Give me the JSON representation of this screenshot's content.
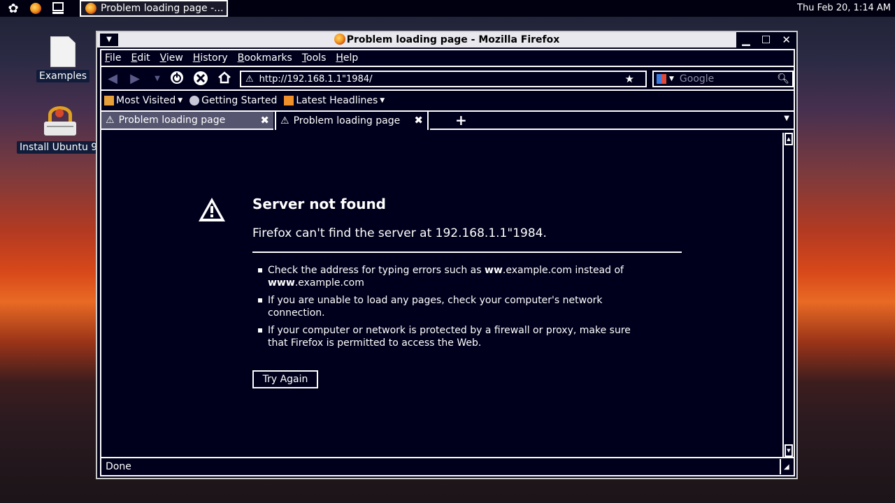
{
  "panel": {
    "task_label": "Problem loading page -...",
    "clock": "Thu Feb 20,  1:14 AM"
  },
  "desktop": {
    "icons": [
      {
        "label": "Examples"
      },
      {
        "label": "Install Ubuntu 9."
      }
    ]
  },
  "window": {
    "title": "Problem loading page - Mozilla Firefox"
  },
  "menubar": [
    "File",
    "Edit",
    "View",
    "History",
    "Bookmarks",
    "Tools",
    "Help"
  ],
  "navbar": {
    "url": "http://192.168.1.1\"1984/",
    "search_placeholder": "Google"
  },
  "bookmarks": [
    "Most Visited",
    "Getting Started",
    "Latest Headlines"
  ],
  "tabs": [
    {
      "label": "Problem loading page"
    },
    {
      "label": "Problem loading page"
    }
  ],
  "error_page": {
    "title": "Server not found",
    "subtitle": "Firefox can't find the server at 192.168.1.1\"1984.",
    "bullet1_prefix": "Check the address for typing errors such as ",
    "bullet1_bold1": "ww",
    "bullet1_mid": ".example.com instead of ",
    "bullet1_bold2": "www",
    "bullet1_suffix": ".example.com",
    "bullet2": "If you are unable to load any pages, check your computer's network connection.",
    "bullet3": "If your computer or network is protected by a firewall or proxy, make sure that Firefox is permitted to access the Web.",
    "try_again": "Try Again"
  },
  "status": "Done"
}
